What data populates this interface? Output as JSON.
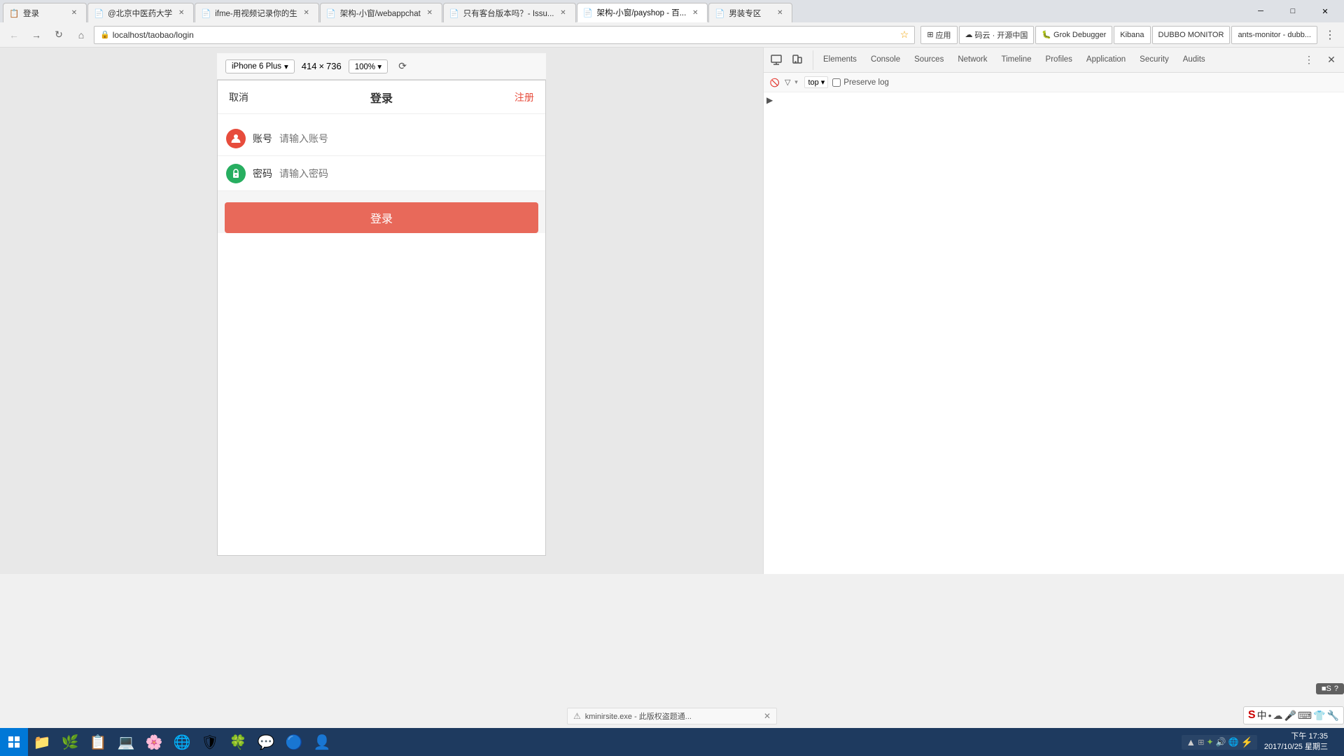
{
  "tabs": [
    {
      "id": "tab1",
      "title": "登录",
      "favicon": "📋",
      "active": false,
      "url": "登录"
    },
    {
      "id": "tab2",
      "title": "@北京中医药大学",
      "favicon": "📄",
      "active": false
    },
    {
      "id": "tab3",
      "title": "ifme-用视频记录你的生",
      "favicon": "📄",
      "active": false
    },
    {
      "id": "tab4",
      "title": "架构-小窗/webappchat",
      "favicon": "📄",
      "active": false
    },
    {
      "id": "tab5",
      "title": "只有客台版本吗？- Issu...",
      "favicon": "📄",
      "active": false
    },
    {
      "id": "tab6",
      "title": "架构-小窗/payshop - 百...",
      "favicon": "📄",
      "active": true
    },
    {
      "id": "tab7",
      "title": "男装专区",
      "favicon": "📄",
      "active": false
    }
  ],
  "address_bar": {
    "url": "localhost/taobao/login",
    "lock_icon": "🔒"
  },
  "nav_buttons": {
    "back": "←",
    "forward": "→",
    "refresh": "↻",
    "home": "⌂"
  },
  "bookmarks": [
    {
      "label": "应用",
      "icon": "⊞"
    },
    {
      "label": "码云 · 开源中国",
      "icon": "☁"
    },
    {
      "label": "Grok Debugger",
      "icon": "🐛"
    },
    {
      "label": "Kibana",
      "icon": "K"
    },
    {
      "label": "DUBBO MONITOR",
      "icon": "D"
    },
    {
      "label": "ants-monitor - dubb...",
      "icon": "A"
    }
  ],
  "mobile": {
    "device": "iPhone 6 Plus",
    "width": "414",
    "height": "736",
    "zoom": "100%",
    "login_page": {
      "cancel": "取消",
      "title": "登录",
      "register": "注册",
      "username_label": "账号",
      "username_placeholder": "请输入账号",
      "password_label": "密码",
      "password_placeholder": "请输入密码",
      "login_btn": "登录"
    }
  },
  "devtools": {
    "tabs": [
      {
        "label": "Elements",
        "active": false
      },
      {
        "label": "Console",
        "active": false
      },
      {
        "label": "Sources",
        "active": false
      },
      {
        "label": "Network",
        "active": false
      },
      {
        "label": "Timeline",
        "active": false
      },
      {
        "label": "Profiles",
        "active": false
      },
      {
        "label": "Application",
        "active": false
      },
      {
        "label": "Security",
        "active": false
      },
      {
        "label": "Audits",
        "active": false
      }
    ],
    "console_bar": {
      "frame_label": "top",
      "preserve_log": "Preserve log"
    }
  },
  "wm_buttons": {
    "minimize": "─",
    "maximize": "□",
    "close": "✕"
  },
  "taskbar": {
    "datetime_time": "下午 17:35",
    "datetime_date": "2017/10/25 星期三",
    "notification_text": "kminirsite.exe - 此版权盗题通...",
    "sogou_label": "中S中♦♣圈□圖♦⚒",
    "sogou_mini": "■S ?"
  }
}
